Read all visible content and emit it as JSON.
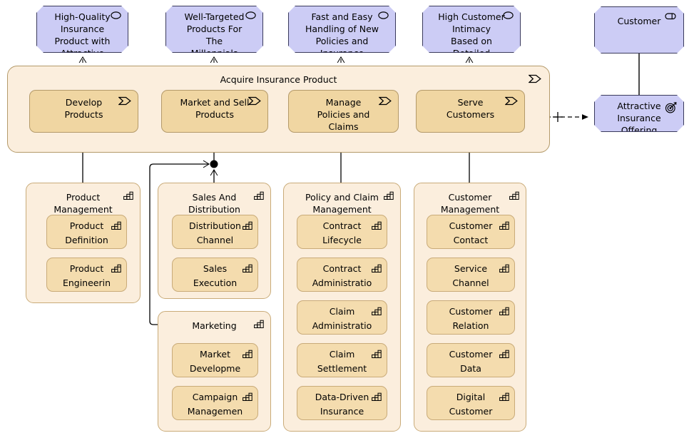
{
  "colors": {
    "motivation_fill": "#ccccf5",
    "motivation_stroke": "#3a3a5c",
    "container_fill": "#fbeedd",
    "process_fill": "#f0d6a2",
    "capability_fill": "#f4dcae",
    "element_stroke": "#b49a6a",
    "line": "#000000"
  },
  "motivation": {
    "goals": [
      {
        "label": "High-Quality\nInsurance\nProduct with\nAttractive",
        "icon": "outcome-oval-icon"
      },
      {
        "label": "Well-Targeted\nProducts For\nThe\nMillennials",
        "icon": "outcome-oval-icon"
      },
      {
        "label": "Fast and Easy\nHandling of New\nPolicies and\nInsurance",
        "icon": "outcome-oval-icon"
      },
      {
        "label": "High Customer\nIntimacy\nBased on\nDetailed",
        "icon": "outcome-oval-icon"
      }
    ],
    "stakeholder": {
      "label": "Customer",
      "icon": "stakeholder-role-icon"
    },
    "offering": {
      "label": "Attractive\nInsurance\nOffering",
      "icon": "goal-target-icon"
    }
  },
  "value_stream": {
    "title": "Acquire Insurance Product",
    "icon": "business-process-icon",
    "processes": [
      {
        "label": "Develop\nProducts",
        "icon": "business-process-icon"
      },
      {
        "label": "Market and Sell\nProducts",
        "icon": "business-process-icon"
      },
      {
        "label": "Manage\nPolicies and\nClaims",
        "icon": "business-process-icon"
      },
      {
        "label": "Serve\nCustomers",
        "icon": "business-process-icon"
      }
    ]
  },
  "capability_groups": [
    {
      "title": "Product\nManagement",
      "icon": "capability-icon",
      "items": [
        {
          "label": "Product\nDefinition",
          "icon": "capability-icon"
        },
        {
          "label": "Product\nEngineerin",
          "icon": "capability-icon"
        }
      ]
    },
    {
      "title": "Sales And\nDistribution",
      "icon": "capability-icon",
      "items": [
        {
          "label": "Distribution\nChannel\n..",
          "icon": "capability-icon"
        },
        {
          "label": "Sales\nExecution",
          "icon": "capability-icon"
        }
      ]
    },
    {
      "title": "Policy and Claim\nManagement",
      "icon": "capability-icon",
      "items": [
        {
          "label": "Contract\nLifecycle\n..            .",
          "icon": "capability-icon"
        },
        {
          "label": "Contract\nAdministratio",
          "icon": "capability-icon"
        },
        {
          "label": "Claim\nAdministratio",
          "icon": "capability-icon"
        },
        {
          "label": "Claim\nSettlement",
          "icon": "capability-icon"
        },
        {
          "label": "Data-Driven\nInsurance",
          "icon": "capability-icon"
        }
      ]
    },
    {
      "title": "Customer\nManagement",
      "icon": "capability-icon",
      "items": [
        {
          "label": "Customer\nContact\n..            .",
          "icon": "capability-icon"
        },
        {
          "label": "Service\nChannel\n..            .",
          "icon": "capability-icon"
        },
        {
          "label": "Customer\nRelation\n..            .",
          "icon": "capability-icon"
        },
        {
          "label": "Customer\nData\n..            .",
          "icon": "capability-icon"
        },
        {
          "label": "Digital\nCustomer\n..            .",
          "icon": "capability-icon"
        }
      ]
    },
    {
      "title": "Marketing",
      "icon": "capability-icon",
      "items": [
        {
          "label": "Market\nDevelopme\n.",
          "icon": "capability-icon"
        },
        {
          "label": "Campaign\nManagemen\n.",
          "icon": "capability-icon"
        }
      ]
    }
  ]
}
